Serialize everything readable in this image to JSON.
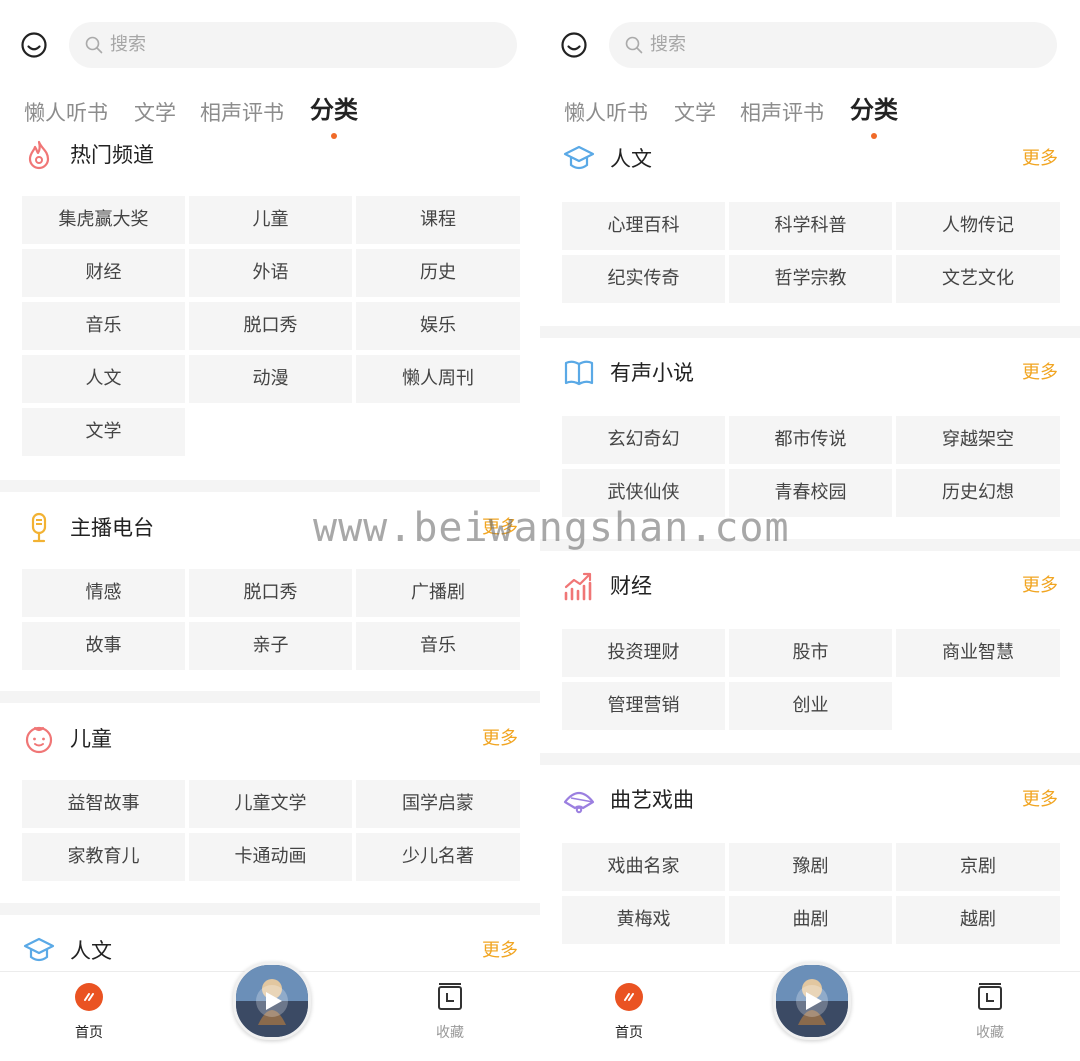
{
  "search_placeholder": "搜索",
  "tabs": [
    "懒人听书",
    "文学",
    "相声评书",
    "分类"
  ],
  "more_label": "更多",
  "left": {
    "hot": {
      "title": "热门频道",
      "items": [
        "集虎赢大奖",
        "儿童",
        "课程",
        "财经",
        "外语",
        "历史",
        "音乐",
        "脱口秀",
        "娱乐",
        "人文",
        "动漫",
        "懒人周刊",
        "文学"
      ]
    },
    "anchor": {
      "title": "主播电台",
      "items": [
        "情感",
        "脱口秀",
        "广播剧",
        "故事",
        "亲子",
        "音乐"
      ]
    },
    "kids": {
      "title": "儿童",
      "items": [
        "益智故事",
        "儿童文学",
        "国学启蒙",
        "家教育儿",
        "卡通动画",
        "少儿名著"
      ]
    },
    "humanities": {
      "title": "人文"
    }
  },
  "right": {
    "humanities": {
      "title": "人文",
      "items": [
        "心理百科",
        "科学科普",
        "人物传记",
        "纪实传奇",
        "哲学宗教",
        "文艺文化"
      ]
    },
    "novel": {
      "title": "有声小说",
      "items": [
        "玄幻奇幻",
        "都市传说",
        "穿越架空",
        "武侠仙侠",
        "青春校园",
        "历史幻想"
      ]
    },
    "finance": {
      "title": "财经",
      "items": [
        "投资理财",
        "股市",
        "商业智慧",
        "管理营销",
        "创业"
      ]
    },
    "opera": {
      "title": "曲艺戏曲",
      "items": [
        "戏曲名家",
        "豫剧",
        "京剧",
        "黄梅戏",
        "曲剧",
        "越剧"
      ]
    }
  },
  "bottom": {
    "home_label": "首页",
    "fav_label": "收藏"
  },
  "watermark": "www.beiwangshan.com",
  "colors": {
    "accent": "#f06a28",
    "more": "#f1a522",
    "cell_bg": "#f5f5f5"
  }
}
